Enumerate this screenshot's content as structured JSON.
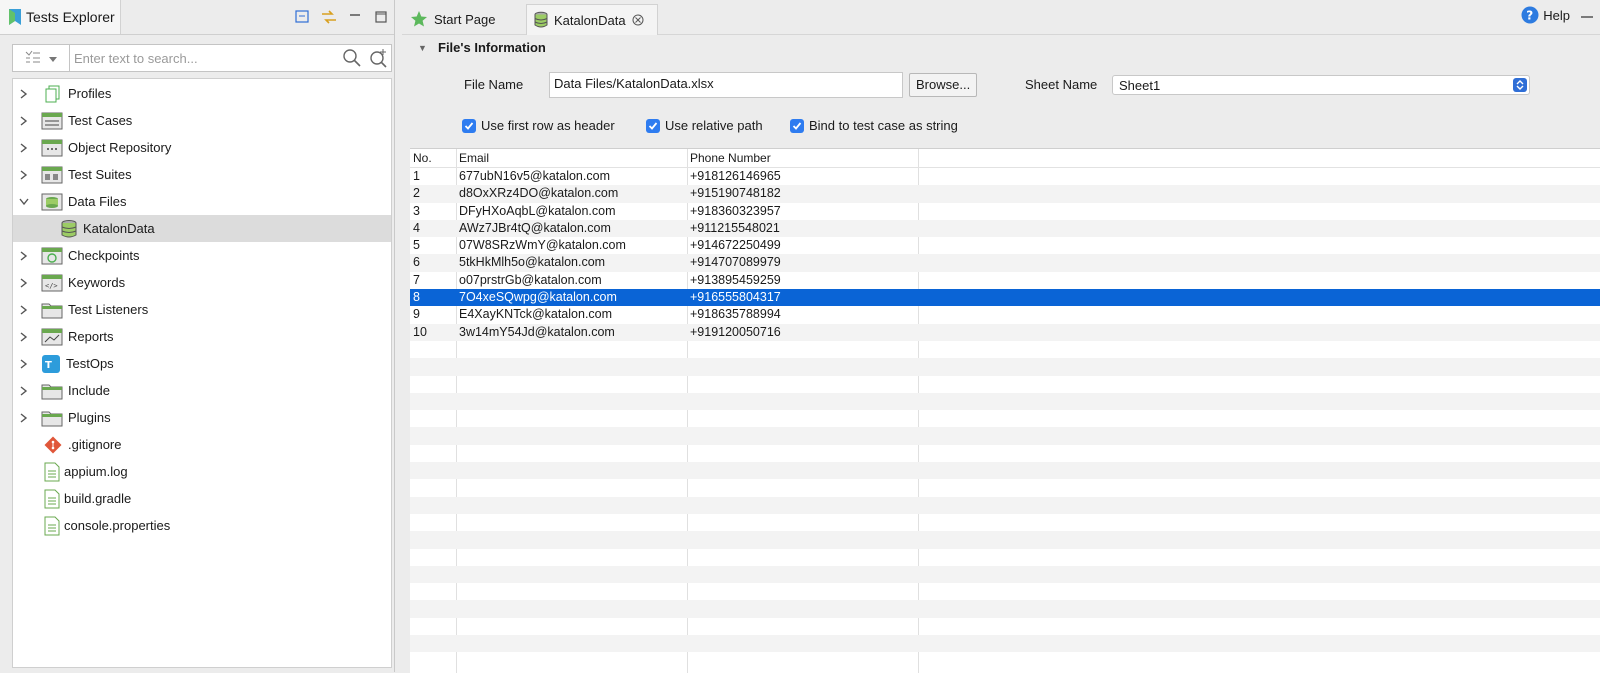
{
  "explorer": {
    "title": "Tests Explorer",
    "search_placeholder": "Enter text to search...",
    "items": [
      {
        "label": "Profiles",
        "icon": "profiles-icon",
        "expandable": true
      },
      {
        "label": "Test Cases",
        "icon": "test-cases-icon",
        "expandable": true
      },
      {
        "label": "Object Repository",
        "icon": "object-repository-icon",
        "expandable": true
      },
      {
        "label": "Test Suites",
        "icon": "test-suites-icon",
        "expandable": true
      },
      {
        "label": "Data Files",
        "icon": "data-files-icon",
        "expandable": true,
        "expanded": true
      },
      {
        "label": "KatalonData",
        "icon": "database-icon",
        "child": true,
        "selected": true
      },
      {
        "label": "Checkpoints",
        "icon": "checkpoints-icon",
        "expandable": true
      },
      {
        "label": "Keywords",
        "icon": "keywords-icon",
        "expandable": true
      },
      {
        "label": "Test Listeners",
        "icon": "folder-icon",
        "expandable": true
      },
      {
        "label": "Reports",
        "icon": "reports-icon",
        "expandable": true
      },
      {
        "label": "TestOps",
        "icon": "testops-icon",
        "expandable": true
      },
      {
        "label": "Include",
        "icon": "folder-icon",
        "expandable": true
      },
      {
        "label": "Plugins",
        "icon": "folder-icon",
        "expandable": true
      },
      {
        "label": ".gitignore",
        "icon": "git-icon"
      },
      {
        "label": "appium.log",
        "icon": "file-icon"
      },
      {
        "label": "build.gradle",
        "icon": "file-icon"
      },
      {
        "label": "console.properties",
        "icon": "file-icon"
      }
    ]
  },
  "editor": {
    "tabs": [
      {
        "label": "Start Page",
        "icon": "star-icon"
      },
      {
        "label": "KatalonData",
        "icon": "database-icon",
        "active": true
      }
    ],
    "help_label": "Help",
    "section_title": "File's Information",
    "file_name_label": "File Name",
    "file_name_value": "Data Files/KatalonData.xlsx",
    "browse_label": "Browse...",
    "sheet_name_label": "Sheet Name",
    "sheet_name_value": "Sheet1",
    "checkboxes": [
      {
        "label": "Use first row as header",
        "checked": true
      },
      {
        "label": "Use relative path",
        "checked": true
      },
      {
        "label": "Bind to test case as string",
        "checked": true
      }
    ]
  },
  "table": {
    "headers": [
      "No.",
      "Email",
      "Phone Number"
    ],
    "rows": [
      [
        "1",
        "677ubN16v5@katalon.com",
        "+918126146965"
      ],
      [
        "2",
        "d8OxXRz4DO@katalon.com",
        "+915190748182"
      ],
      [
        "3",
        "DFyHXoAqbL@katalon.com",
        "+918360323957"
      ],
      [
        "4",
        "AWz7JBr4tQ@katalon.com",
        "+911215548021"
      ],
      [
        "5",
        "07W8SRzWmY@katalon.com",
        "+914672250499"
      ],
      [
        "6",
        "5tkHkMlh5o@katalon.com",
        "+914707089979"
      ],
      [
        "7",
        "o07prstrGb@katalon.com",
        "+913895459259"
      ],
      [
        "8",
        "7O4xeSQwpg@katalon.com",
        "+916555804317"
      ],
      [
        "9",
        "E4XayKNTck@katalon.com",
        "+918635788994"
      ],
      [
        "10",
        "3w14mY54Jd@katalon.com",
        "+919120050716"
      ]
    ],
    "selected_row": 8
  },
  "colors": {
    "selection": "#0a64d6",
    "checkbox": "#2e7cf0",
    "accent_green": "#4caf50"
  }
}
